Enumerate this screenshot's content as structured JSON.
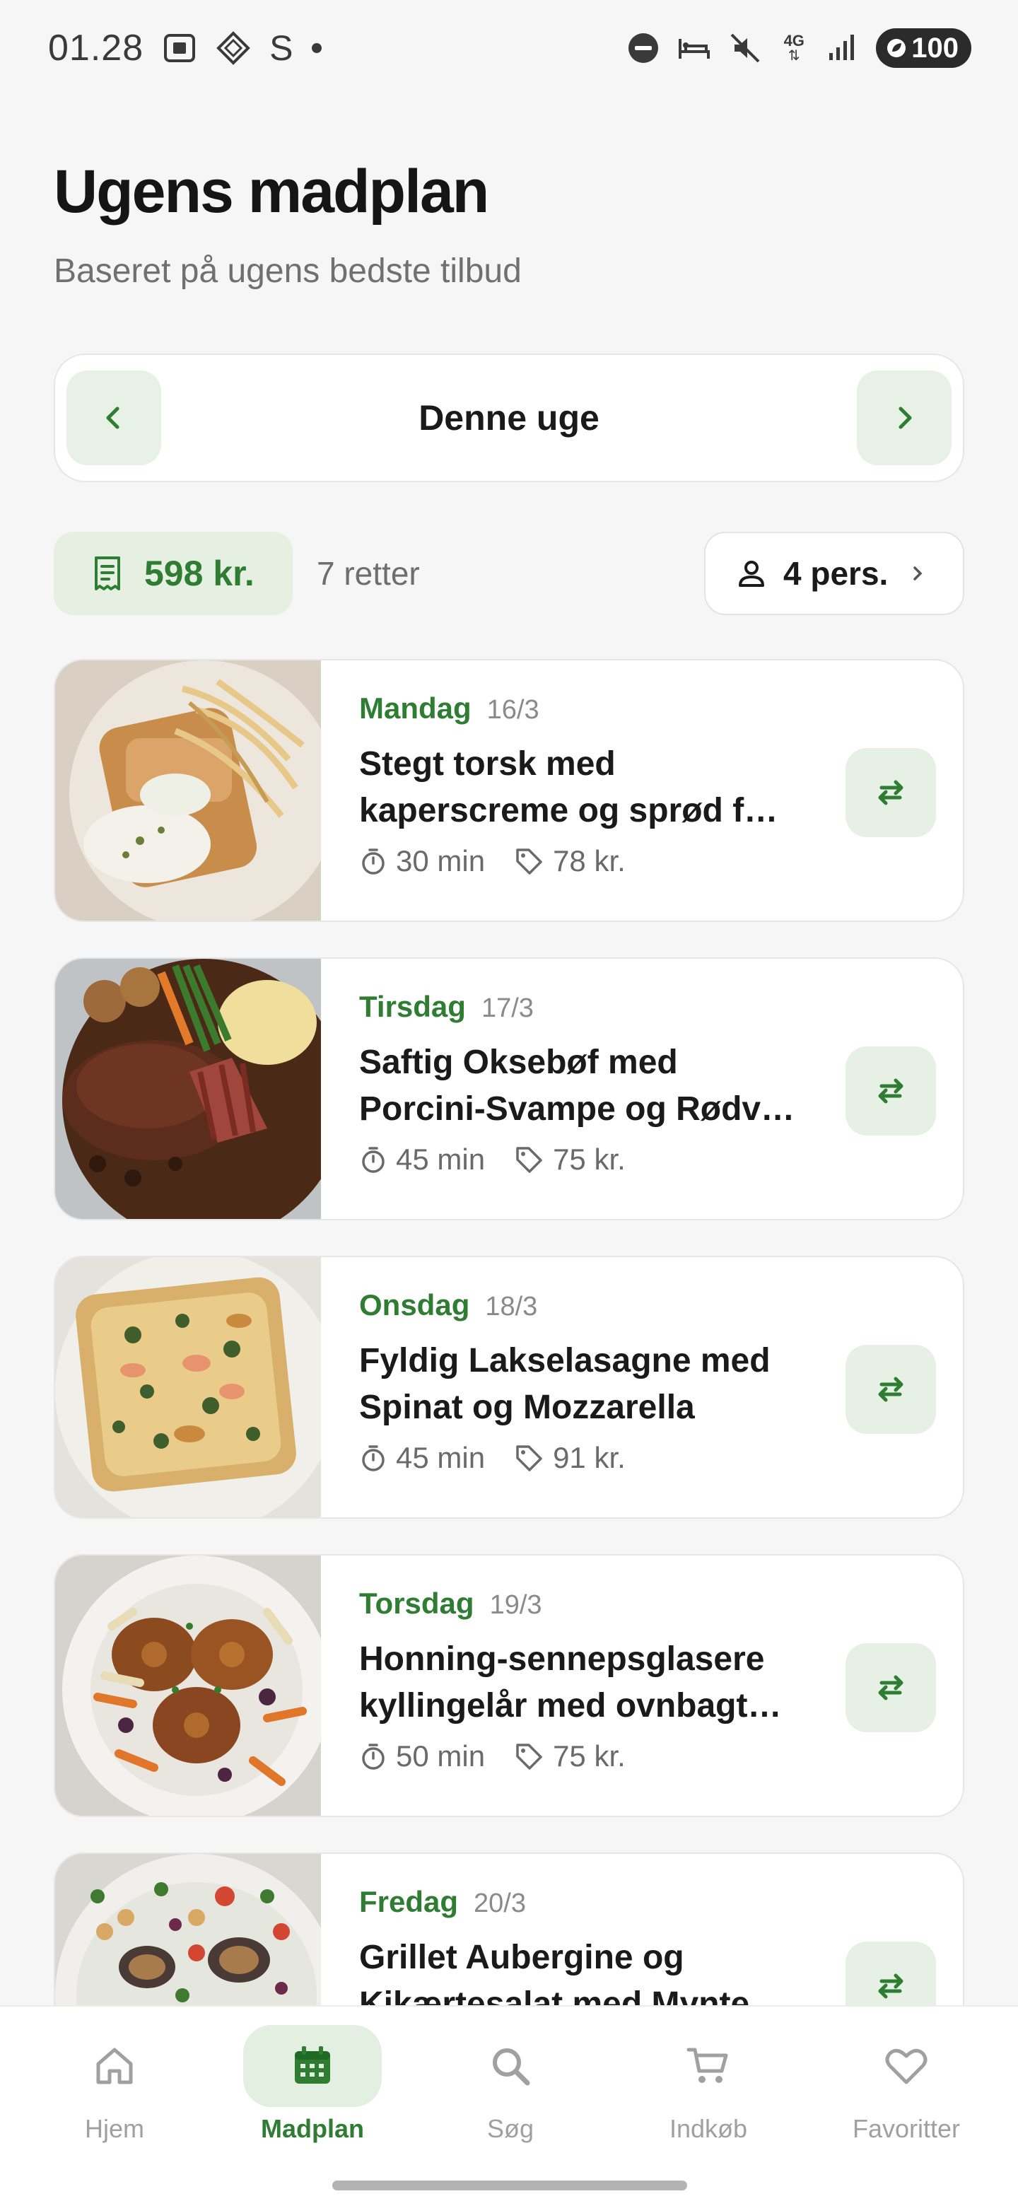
{
  "status_bar": {
    "time": "01.28",
    "carrier_letter": "S",
    "network": "4G",
    "battery": "100"
  },
  "header": {
    "title": "Ugens madplan",
    "subtitle": "Baseret på ugens bedste tilbud"
  },
  "week_selector": {
    "label": "Denne uge",
    "prev_icon": "chevron-left-icon",
    "next_icon": "chevron-right-icon"
  },
  "summary": {
    "total_price": "598 kr.",
    "dish_count": "7 retter",
    "persons": "4 pers."
  },
  "meals": [
    {
      "day": "Mandag",
      "date": "16/3",
      "title_line1": "Stegt torsk med",
      "title_line2": "kaperscreme og sprød f…",
      "time": "30 min",
      "price": "78 kr."
    },
    {
      "day": "Tirsdag",
      "date": "17/3",
      "title_line1": "Saftig Oksebøf med",
      "title_line2": "Porcini-Svampe og Rødv…",
      "time": "45 min",
      "price": "75 kr."
    },
    {
      "day": "Onsdag",
      "date": "18/3",
      "title_line1": "Fyldig Lakselasagne med",
      "title_line2": "Spinat og Mozzarella",
      "time": "45 min",
      "price": "91 kr."
    },
    {
      "day": "Torsdag",
      "date": "19/3",
      "title_line1": "Honning-sennepsglasere",
      "title_line2": "kyllingelår med ovnbagt…",
      "time": "50 min",
      "price": "75 kr."
    },
    {
      "day": "Fredag",
      "date": "20/3",
      "title_line1": "Grillet Aubergine og",
      "title_line2": "Kikærtesalat med Mynte",
      "time": "",
      "price": ""
    }
  ],
  "bottom_nav": [
    {
      "label": "Hjem",
      "icon": "home-icon"
    },
    {
      "label": "Madplan",
      "icon": "calendar-icon",
      "active": true
    },
    {
      "label": "Søg",
      "icon": "search-icon"
    },
    {
      "label": "Indkøb",
      "icon": "cart-icon"
    },
    {
      "label": "Favoritter",
      "icon": "heart-icon"
    }
  ],
  "colors": {
    "accent": "#2e7d32",
    "accent_bg": "#e5f0e3",
    "background": "#f6f6f6"
  }
}
